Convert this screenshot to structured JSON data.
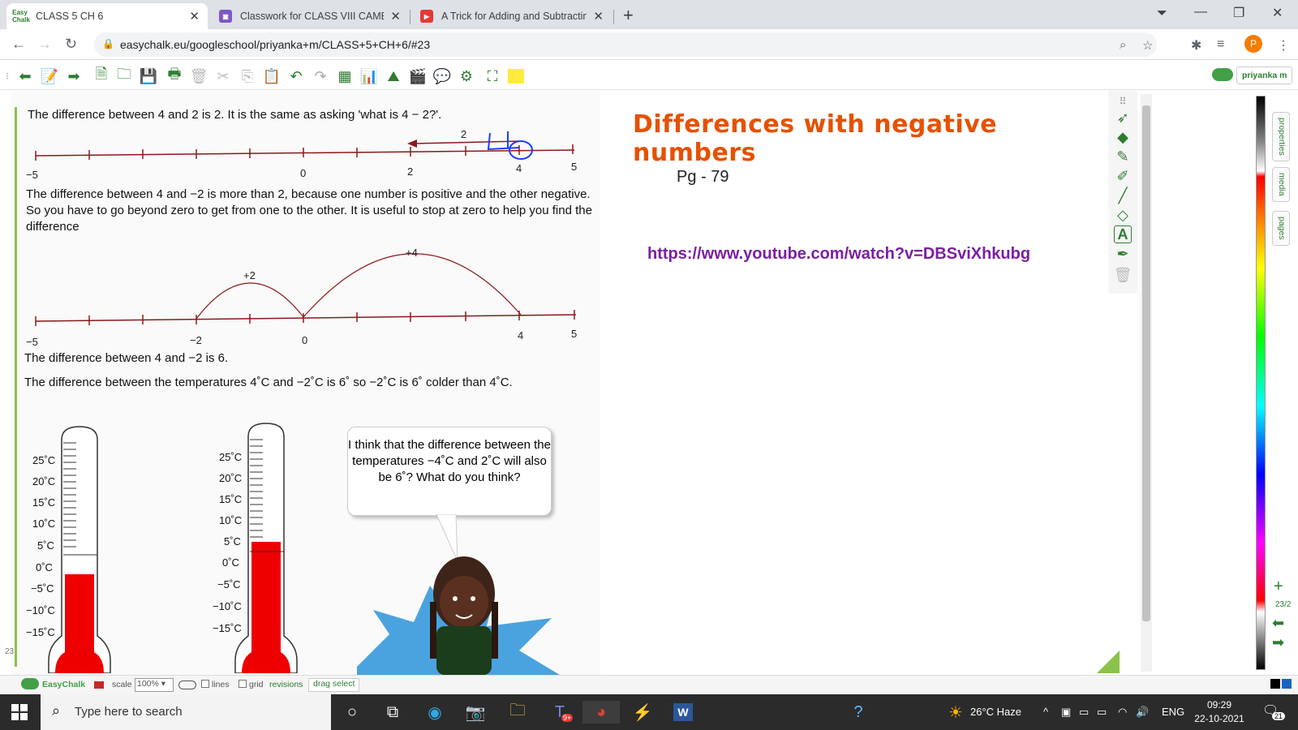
{
  "browser": {
    "tabs": [
      {
        "title": "CLASS 5 CH 6",
        "favicon": "Easy Chalk",
        "active": true
      },
      {
        "title": "Classwork for CLASS VIII CAMBRI",
        "active": false
      },
      {
        "title": "A Trick for Adding and Subtractin",
        "active": false
      }
    ],
    "url": "easychalk.eu/googleschool/priyanka+m/CLASS+5+CH+6/#23",
    "profile_initial": "P"
  },
  "easychalk": {
    "user": "priyanka m",
    "page_number": "23",
    "page_counter": "23/2",
    "side_tabs": [
      "properties",
      "media",
      "pages"
    ]
  },
  "board": {
    "para1": "The difference between 4 and 2 is 2. It is the same as asking 'what is 4 − 2?'.",
    "nl1_labels": [
      "−5",
      "0",
      "2",
      "4",
      "5"
    ],
    "nl1_jump": "2",
    "para2": "The difference between 4 and −2 is more than 2, because one number is positive and the other negative. So you have to go beyond zero to get from one to the other. It is useful to stop at zero to help you find the difference",
    "nl2_labels": [
      "−5",
      "−2",
      "0",
      "4",
      "5"
    ],
    "nl2_jumps": [
      "+2",
      "+4"
    ],
    "para3": "The difference between 4 and −2 is 6.",
    "para4": "The difference between the temperatures 4˚C and −2˚C is 6˚ so −2˚C is 6˚ colder than 4˚C.",
    "thermo_labels": [
      "25˚C",
      "20˚C",
      "15˚C",
      "10˚C",
      "5˚C",
      "0˚C",
      "−5˚C",
      "−10˚C",
      "−15˚C"
    ],
    "bubble": "I think that the difference between the temperatures −4˚C and 2˚C will also be 6˚? What do you think?",
    "heading": "Differences with negative numbers",
    "page_ref": "Pg - 79",
    "link": "https://www.youtube.com/watch?v=DBSviXhkubg"
  },
  "statusbar": {
    "brand": "EasyChalk",
    "scale_label": "scale",
    "scale_value": "100%",
    "lines": "lines",
    "grid": "grid",
    "revisions": "revisions",
    "drag_select": "drag select"
  },
  "taskbar": {
    "search_placeholder": "Type here to search",
    "weather": "26°C  Haze",
    "lang": "ENG",
    "time": "09:29",
    "date": "22-10-2021",
    "notifications": "21",
    "teams_badge": "9+"
  }
}
